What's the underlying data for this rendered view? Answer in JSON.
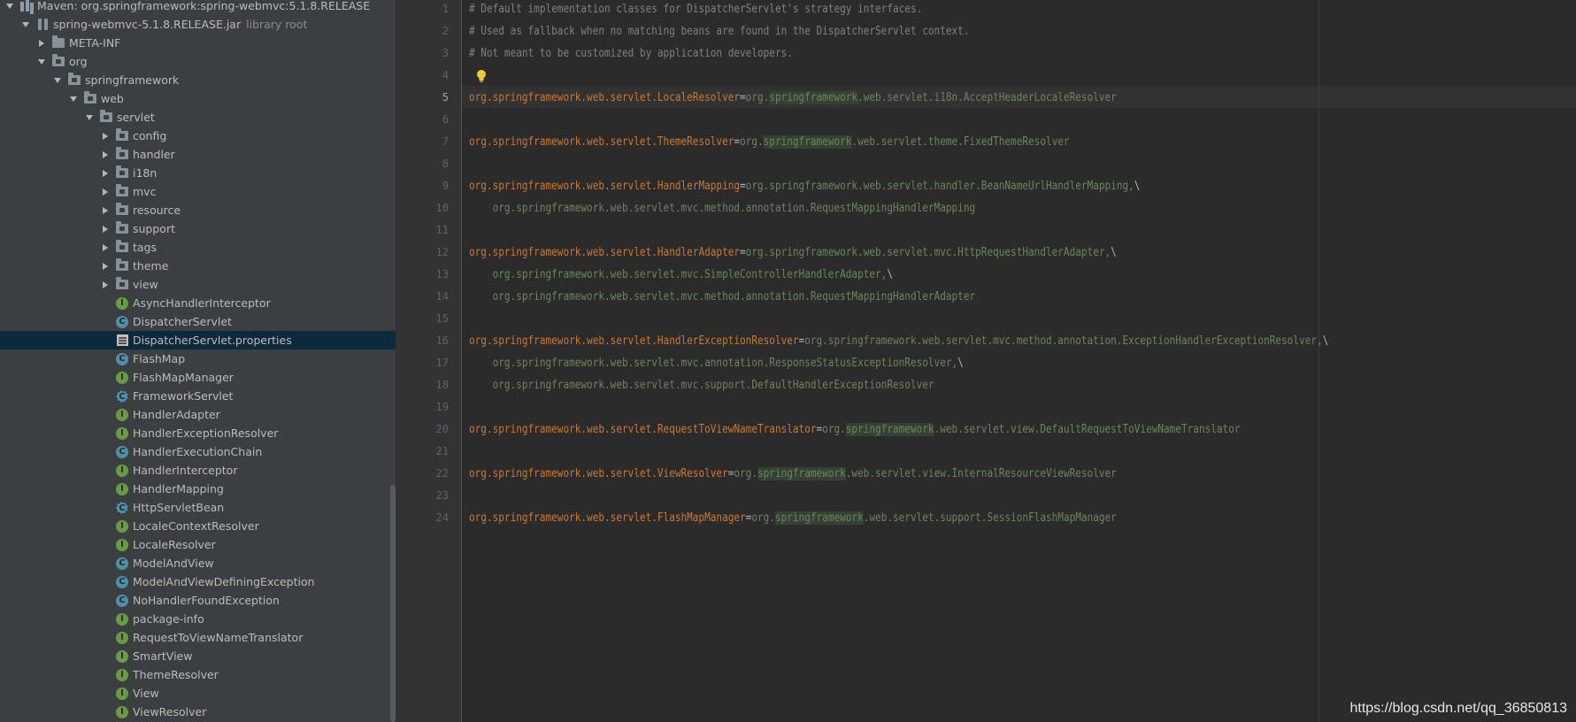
{
  "project_tree": {
    "items": [
      {
        "label": "Maven: org.springframework:spring-webmvc:5.1.8.RELEASE",
        "sub": "",
        "icon": "maven-library-icon",
        "level": 0,
        "arrow": "down",
        "selected": false
      },
      {
        "label": "spring-webmvc-5.1.8.RELEASE.jar",
        "sub": "library root",
        "icon": "jar-icon",
        "level": 1,
        "arrow": "down",
        "selected": false
      },
      {
        "label": "META-INF",
        "sub": "",
        "icon": "folder-icon",
        "level": 2,
        "arrow": "right",
        "selected": false
      },
      {
        "label": "org",
        "sub": "",
        "icon": "package-icon",
        "level": 2,
        "arrow": "down",
        "selected": false
      },
      {
        "label": "springframework",
        "sub": "",
        "icon": "package-icon",
        "level": 3,
        "arrow": "down",
        "selected": false
      },
      {
        "label": "web",
        "sub": "",
        "icon": "package-icon",
        "level": 4,
        "arrow": "down",
        "selected": false
      },
      {
        "label": "servlet",
        "sub": "",
        "icon": "package-icon",
        "level": 5,
        "arrow": "down",
        "selected": false
      },
      {
        "label": "config",
        "sub": "",
        "icon": "package-icon",
        "level": 6,
        "arrow": "right",
        "selected": false
      },
      {
        "label": "handler",
        "sub": "",
        "icon": "package-icon",
        "level": 6,
        "arrow": "right",
        "selected": false
      },
      {
        "label": "i18n",
        "sub": "",
        "icon": "package-icon",
        "level": 6,
        "arrow": "right",
        "selected": false
      },
      {
        "label": "mvc",
        "sub": "",
        "icon": "package-icon",
        "level": 6,
        "arrow": "right",
        "selected": false
      },
      {
        "label": "resource",
        "sub": "",
        "icon": "package-icon",
        "level": 6,
        "arrow": "right",
        "selected": false
      },
      {
        "label": "support",
        "sub": "",
        "icon": "package-icon",
        "level": 6,
        "arrow": "right",
        "selected": false
      },
      {
        "label": "tags",
        "sub": "",
        "icon": "package-icon",
        "level": 6,
        "arrow": "right",
        "selected": false
      },
      {
        "label": "theme",
        "sub": "",
        "icon": "package-icon",
        "level": 6,
        "arrow": "right",
        "selected": false
      },
      {
        "label": "view",
        "sub": "",
        "icon": "package-icon",
        "level": 6,
        "arrow": "right",
        "selected": false
      },
      {
        "label": "AsyncHandlerInterceptor",
        "sub": "",
        "icon": "interface-icon",
        "level": 6,
        "arrow": "none",
        "selected": false
      },
      {
        "label": "DispatcherServlet",
        "sub": "",
        "icon": "class-icon",
        "level": 6,
        "arrow": "none",
        "selected": false
      },
      {
        "label": "DispatcherServlet.properties",
        "sub": "",
        "icon": "properties-file-icon",
        "level": 6,
        "arrow": "none",
        "selected": true
      },
      {
        "label": "FlashMap",
        "sub": "",
        "icon": "class-icon",
        "level": 6,
        "arrow": "none",
        "selected": false
      },
      {
        "label": "FlashMapManager",
        "sub": "",
        "icon": "interface-icon",
        "level": 6,
        "arrow": "none",
        "selected": false
      },
      {
        "label": "FrameworkServlet",
        "sub": "",
        "icon": "abstract-class-icon",
        "level": 6,
        "arrow": "none",
        "selected": false
      },
      {
        "label": "HandlerAdapter",
        "sub": "",
        "icon": "interface-icon",
        "level": 6,
        "arrow": "none",
        "selected": false
      },
      {
        "label": "HandlerExceptionResolver",
        "sub": "",
        "icon": "interface-icon",
        "level": 6,
        "arrow": "none",
        "selected": false
      },
      {
        "label": "HandlerExecutionChain",
        "sub": "",
        "icon": "class-icon",
        "level": 6,
        "arrow": "none",
        "selected": false
      },
      {
        "label": "HandlerInterceptor",
        "sub": "",
        "icon": "interface-icon",
        "level": 6,
        "arrow": "none",
        "selected": false
      },
      {
        "label": "HandlerMapping",
        "sub": "",
        "icon": "interface-icon",
        "level": 6,
        "arrow": "none",
        "selected": false
      },
      {
        "label": "HttpServletBean",
        "sub": "",
        "icon": "abstract-class-icon",
        "level": 6,
        "arrow": "none",
        "selected": false
      },
      {
        "label": "LocaleContextResolver",
        "sub": "",
        "icon": "interface-icon",
        "level": 6,
        "arrow": "none",
        "selected": false
      },
      {
        "label": "LocaleResolver",
        "sub": "",
        "icon": "interface-icon",
        "level": 6,
        "arrow": "none",
        "selected": false
      },
      {
        "label": "ModelAndView",
        "sub": "",
        "icon": "class-icon",
        "level": 6,
        "arrow": "none",
        "selected": false
      },
      {
        "label": "ModelAndViewDefiningException",
        "sub": "",
        "icon": "class-icon",
        "level": 6,
        "arrow": "none",
        "selected": false
      },
      {
        "label": "NoHandlerFoundException",
        "sub": "",
        "icon": "class-icon",
        "level": 6,
        "arrow": "none",
        "selected": false
      },
      {
        "label": "package-info",
        "sub": "",
        "icon": "interface-icon",
        "level": 6,
        "arrow": "none",
        "selected": false
      },
      {
        "label": "RequestToViewNameTranslator",
        "sub": "",
        "icon": "interface-icon",
        "level": 6,
        "arrow": "none",
        "selected": false
      },
      {
        "label": "SmartView",
        "sub": "",
        "icon": "interface-icon",
        "level": 6,
        "arrow": "none",
        "selected": false
      },
      {
        "label": "ThemeResolver",
        "sub": "",
        "icon": "interface-icon",
        "level": 6,
        "arrow": "none",
        "selected": false
      },
      {
        "label": "View",
        "sub": "",
        "icon": "interface-icon",
        "level": 6,
        "arrow": "none",
        "selected": false
      },
      {
        "label": "ViewResolver",
        "sub": "",
        "icon": "interface-icon",
        "level": 6,
        "arrow": "none",
        "selected": false
      }
    ]
  },
  "editor": {
    "current_line": 5,
    "lines": [
      [
        {
          "t": "comment",
          "s": "# Default implementation classes for DispatcherServlet's strategy interfaces."
        }
      ],
      [
        {
          "t": "comment",
          "s": "# Used as fallback when no matching beans are found in the DispatcherServlet context."
        }
      ],
      [
        {
          "t": "comment",
          "s": "# Not meant to be customized by application developers."
        }
      ],
      [],
      [
        {
          "t": "key",
          "s": "org.springframework.web.servlet.LocaleResolver"
        },
        {
          "t": "eq",
          "s": "="
        },
        {
          "t": "val",
          "s": "org."
        },
        {
          "t": "val hl",
          "s": "springframework"
        },
        {
          "t": "val",
          "s": ".web.servlet.i18n.AcceptHeaderLocaleResolver"
        }
      ],
      [],
      [
        {
          "t": "key",
          "s": "org.springframework.web.servlet.ThemeResolver"
        },
        {
          "t": "eq",
          "s": "="
        },
        {
          "t": "val",
          "s": "org."
        },
        {
          "t": "val hl",
          "s": "springframework"
        },
        {
          "t": "val",
          "s": ".web.servlet.theme.FixedThemeResolver"
        }
      ],
      [],
      [
        {
          "t": "key",
          "s": "org.springframework.web.servlet.HandlerMapping"
        },
        {
          "t": "eq",
          "s": "="
        },
        {
          "t": "val",
          "s": "org.springframework.web.servlet.handler.BeanNameUrlHandlerMapping,"
        },
        {
          "t": "eq",
          "s": "\\"
        }
      ],
      [
        {
          "t": "val",
          "s": "    org.springframework.web.servlet.mvc.method.annotation.RequestMappingHandlerMapping"
        }
      ],
      [],
      [
        {
          "t": "key",
          "s": "org.springframework.web.servlet.HandlerAdapter"
        },
        {
          "t": "eq",
          "s": "="
        },
        {
          "t": "val",
          "s": "org.springframework.web.servlet.mvc.HttpRequestHandlerAdapter,"
        },
        {
          "t": "eq",
          "s": "\\"
        }
      ],
      [
        {
          "t": "val",
          "s": "    org.springframework.web.servlet.mvc.SimpleControllerHandlerAdapter,"
        },
        {
          "t": "eq",
          "s": "\\"
        }
      ],
      [
        {
          "t": "val",
          "s": "    org.springframework.web.servlet.mvc.method.annotation.RequestMappingHandlerAdapter"
        }
      ],
      [],
      [
        {
          "t": "key",
          "s": "org.springframework.web.servlet.HandlerExceptionResolver"
        },
        {
          "t": "eq",
          "s": "="
        },
        {
          "t": "val",
          "s": "org.springframework.web.servlet.mvc.method.annotation.ExceptionHandlerExceptionResolver,"
        },
        {
          "t": "eq",
          "s": "\\"
        }
      ],
      [
        {
          "t": "val",
          "s": "    org.springframework.web.servlet.mvc.annotation.ResponseStatusExceptionResolver,"
        },
        {
          "t": "eq",
          "s": "\\"
        }
      ],
      [
        {
          "t": "val",
          "s": "    org.springframework.web.servlet.mvc.support.DefaultHandlerExceptionResolver"
        }
      ],
      [],
      [
        {
          "t": "key",
          "s": "org.springframework.web.servlet.RequestToViewNameTranslator"
        },
        {
          "t": "eq",
          "s": "="
        },
        {
          "t": "val",
          "s": "org."
        },
        {
          "t": "val hl",
          "s": "springframework"
        },
        {
          "t": "val",
          "s": ".web.servlet.view.DefaultRequestToViewNameTranslator"
        }
      ],
      [],
      [
        {
          "t": "key",
          "s": "org.springframework.web.servlet.ViewResolver"
        },
        {
          "t": "eq",
          "s": "="
        },
        {
          "t": "val",
          "s": "org."
        },
        {
          "t": "val hl",
          "s": "springframework"
        },
        {
          "t": "val",
          "s": ".web.servlet.view.InternalResourceViewResolver"
        }
      ],
      [],
      [
        {
          "t": "key",
          "s": "org.springframework.web.servlet.FlashMapManager"
        },
        {
          "t": "eq",
          "s": "="
        },
        {
          "t": "val",
          "s": "org."
        },
        {
          "t": "val hl",
          "s": "springframework"
        },
        {
          "t": "val",
          "s": ".web.servlet.support.SessionFlashMapManager"
        }
      ]
    ]
  },
  "watermark": "https://blog.csdn.net/qq_36850813",
  "colors": {
    "keyword": "#cc7832",
    "string": "#6a8759",
    "comment": "#808080",
    "selection": "#0d293e"
  }
}
